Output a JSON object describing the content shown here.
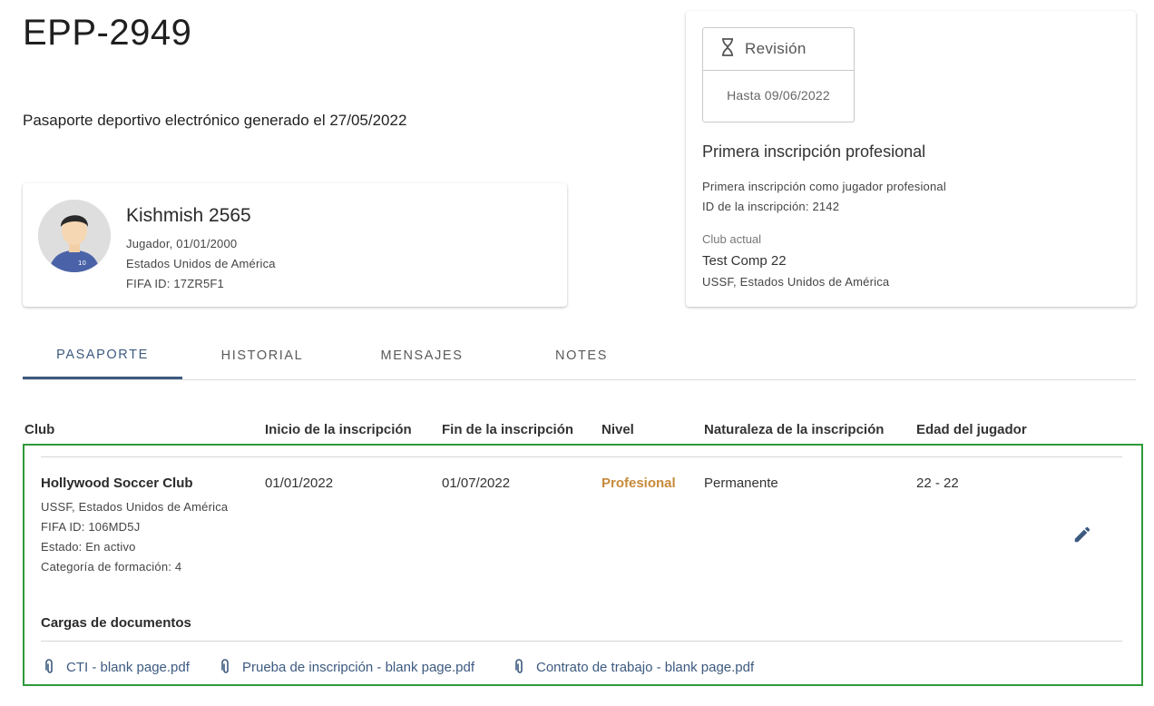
{
  "header": {
    "title": "EPP-2949",
    "subtitle": "Pasaporte deportivo electrónico generado el 27/05/2022"
  },
  "player": {
    "name": "Kishmish 2565",
    "role_dob": "Jugador, 01/01/2000",
    "country": "Estados Unidos de América",
    "fifa_id": "FIFA ID: 17ZR5F1",
    "jersey_number": "10"
  },
  "registration": {
    "status_label": "Revisión",
    "status_until": "Hasta 09/06/2022",
    "title": "Primera inscripción profesional",
    "description": "Primera inscripción como jugador profesional",
    "registration_id": "ID de la inscripción: 2142",
    "current_club_label": "Club actual",
    "current_club_name": "Test Comp 22",
    "current_club_assoc": "USSF, Estados Unidos de América"
  },
  "tabs": [
    {
      "label": "PASAPORTE",
      "active": true
    },
    {
      "label": "HISTORIAL",
      "active": false
    },
    {
      "label": "MENSAJES",
      "active": false
    },
    {
      "label": "NOTES",
      "active": false
    }
  ],
  "table": {
    "headers": [
      "Club",
      "Inicio de la inscripción",
      "Fin de la inscripción",
      "Nivel",
      "Naturaleza de la inscripción",
      "Edad del jugador"
    ],
    "row": {
      "club_name": "Hollywood Soccer Club",
      "club_assoc": "USSF, Estados Unidos de América",
      "club_fifa_id": "FIFA ID: 106MD5J",
      "club_status": "Estado: En activo",
      "club_category": "Categoría de formación: 4",
      "start": "01/01/2022",
      "end": "01/07/2022",
      "level": "Profesional",
      "nature": "Permanente",
      "age": "22 - 22"
    },
    "documents_title": "Cargas de documentos",
    "documents": [
      "CTI - blank page.pdf",
      "Prueba de inscripción - blank page.pdf",
      "Contrato de trabajo - blank page.pdf"
    ]
  },
  "colors": {
    "accent": "#3d5a80",
    "level": "#c78a3a",
    "highlight_border": "#2e9a3a"
  }
}
